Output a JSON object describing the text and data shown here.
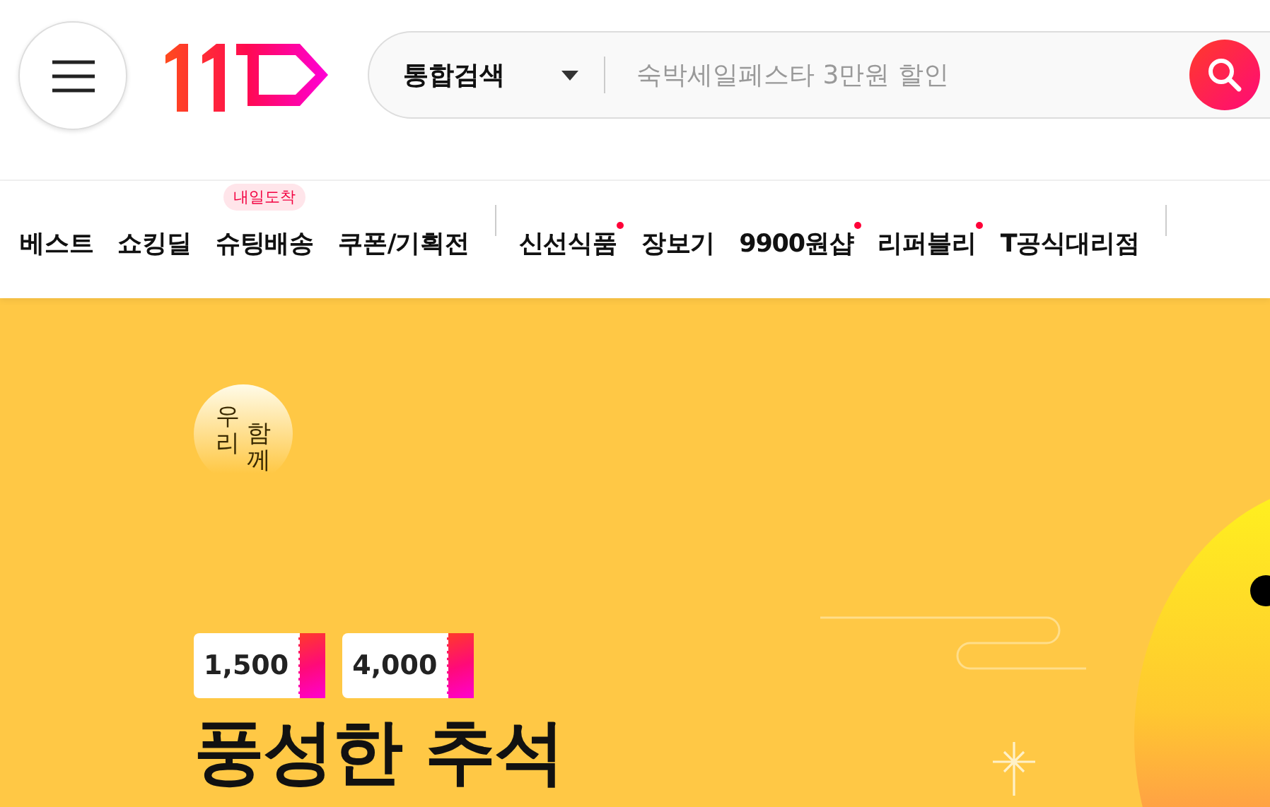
{
  "search": {
    "scope": "통합검색",
    "placeholder": "숙박세일페스타 3만원 할인"
  },
  "nav": {
    "groups": [
      [
        {
          "label": "베스트",
          "dot": false
        },
        {
          "label": "쇼킹딜",
          "dot": false
        },
        {
          "label": "슈팅배송",
          "dot": false,
          "badge": "내일도착"
        },
        {
          "label": "쿠폰/기획전",
          "dot": false
        }
      ],
      [
        {
          "label": "신선식품",
          "dot": true
        },
        {
          "label": "장보기",
          "dot": false
        },
        {
          "label": "9900원샵",
          "dot": true
        },
        {
          "label": "리퍼블리",
          "dot": true
        },
        {
          "label": "T공식대리점",
          "dot": false
        }
      ]
    ]
  },
  "banner": {
    "emblem": [
      "우리",
      "함께"
    ],
    "coupons": [
      "1,500",
      "4,000"
    ],
    "headline": "풍성한 추석"
  }
}
